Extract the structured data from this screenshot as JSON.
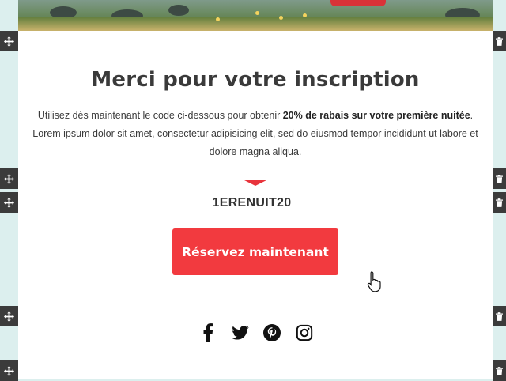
{
  "email": {
    "title": "Merci pour votre inscription",
    "intro_prefix": "Utilisez dès maintenant le code ci-dessous pour obtenir ",
    "intro_bold": "20% de rabais sur votre première nuitée",
    "intro_suffix": ". Lorem ipsum dolor sit amet, consectetur adipisicing elit, sed do eiusmod tempor incididunt ut labore et dolore magna aliqua.",
    "promo_code": "1ERENUIT20",
    "cta_label": "Réservez maintenant",
    "accent_color": "#f23a3f",
    "social_icons": [
      "facebook-icon",
      "twitter-icon",
      "pinterest-icon",
      "instagram-icon"
    ]
  },
  "editor": {
    "move_icon": "move-icon",
    "delete_icon": "trash-icon",
    "sidebar_color": "#3b3b3b",
    "background_color": "#dcefee"
  }
}
